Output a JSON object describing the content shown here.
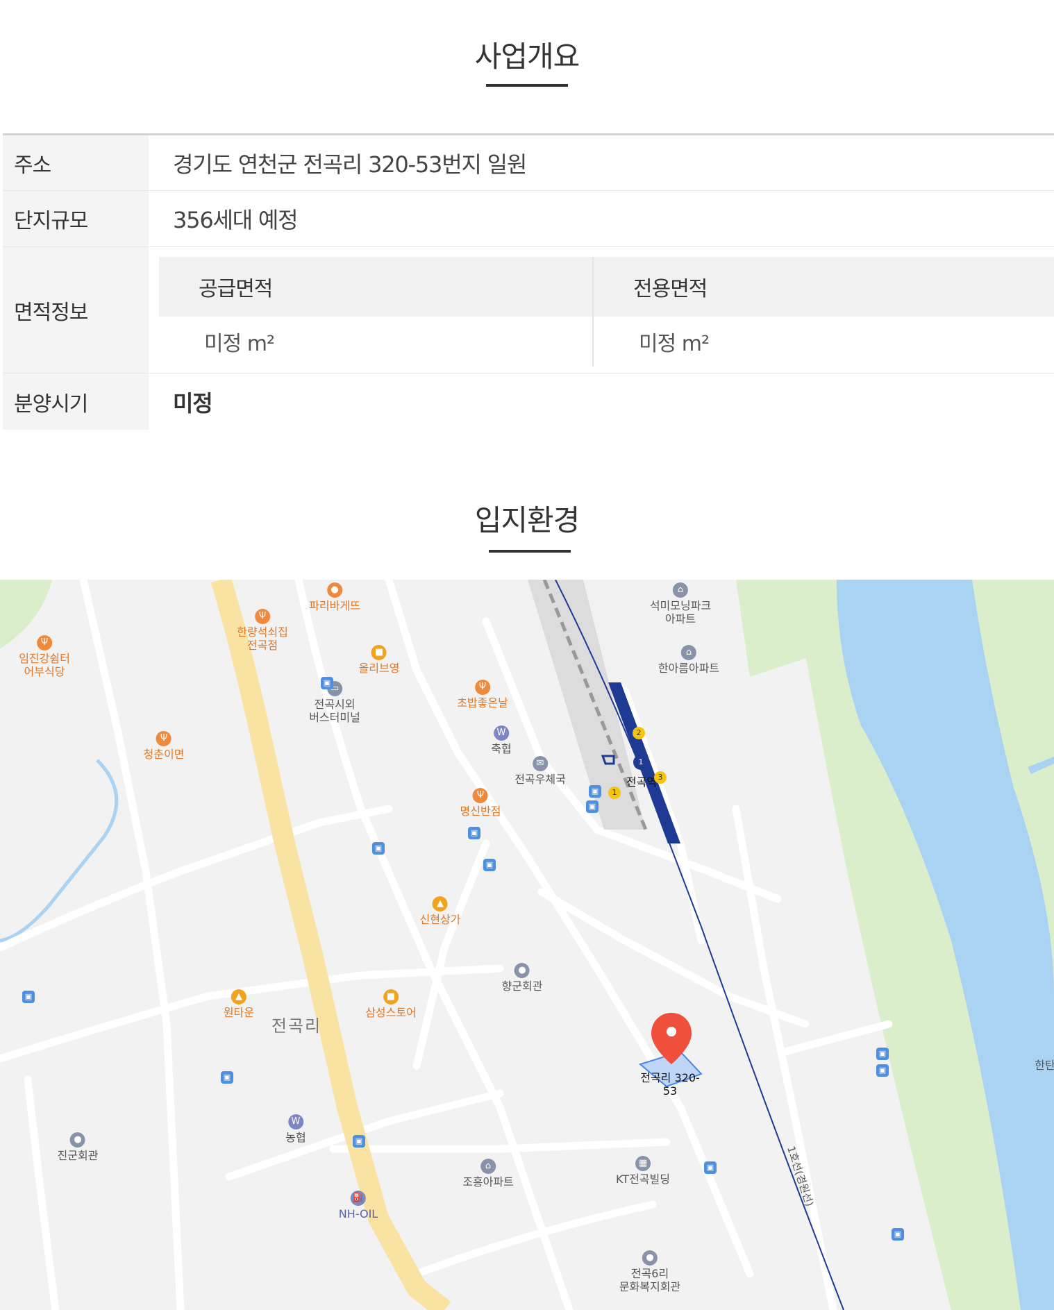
{
  "overview": {
    "title": "사업개요",
    "rows": {
      "address": {
        "label": "주소",
        "value": "경기도 연천군 전곡리 320-53번지 일원"
      },
      "scale": {
        "label": "단지규모",
        "value": "356세대 예정"
      },
      "area": {
        "label": "면적정보",
        "supply_label": "공급면적",
        "supply_value": "미정 m²",
        "exclusive_label": "전용면적",
        "exclusive_value": "미정 m²"
      },
      "sale": {
        "label": "분양시기",
        "value": "미정"
      }
    }
  },
  "location": {
    "title": "입지환경",
    "map": {
      "colors": {
        "water": "#a9d2f3",
        "green": "#dbeecb",
        "main_road": "#f8e3a3",
        "rail": "#1f3a93",
        "marker": "#ef4f3c"
      },
      "marker_label_line1": "전곡리 320-",
      "marker_label_line2": "53",
      "area_label": "전곡리",
      "station_label": "전곡역",
      "rail_line_label": "1호선(경원선)",
      "edge_label": "한탄",
      "pois": {
        "paris": "파리바게뜨",
        "hanyang_1": "한량석쇠집",
        "hanyang_2": "전곡점",
        "imjin_1": "임진강쉼터",
        "imjin_2": "어부식당",
        "olive": "올리브영",
        "bus_terminal_1": "전곡시외",
        "bus_terminal_2": "버스터미널",
        "chobap": "초밥좋은날",
        "cheongchun": "청춘이면",
        "nonghyup_1": "축협",
        "post": "전곡우체국",
        "myeongsin": "명신반점",
        "seokmi_1": "석미모닝파크",
        "seokmi_2": "아파트",
        "hanareum": "한아름아파트",
        "sinhyeon": "신현상가",
        "hyanggun": "향군회관",
        "wontaun": "원타운",
        "samsung": "삼성스토어",
        "nonghyup_2": "농협",
        "jingun": "진군회관",
        "nhoil": "NH-OIL",
        "joheung": "조흥아파트",
        "kt": "KT전곡빌딩",
        "welfare_1": "전곡6리",
        "welfare_2": "문화복지회관"
      }
    }
  }
}
